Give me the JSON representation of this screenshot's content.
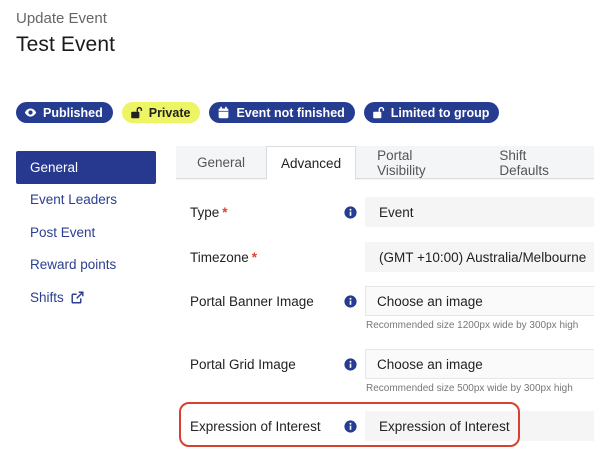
{
  "header": {
    "subtitle": "Update Event",
    "title": "Test Event"
  },
  "badges": [
    {
      "label": "Published",
      "icon": "eye-icon",
      "color": "#263c91"
    },
    {
      "label": "Private",
      "icon": "unlock-icon",
      "color": "#eef564"
    },
    {
      "label": "Event not finished",
      "icon": "calendar-icon",
      "color": "#263c91"
    },
    {
      "label": "Limited to group",
      "icon": "unlock-icon",
      "color": "#263c91"
    }
  ],
  "sidebar": {
    "items": [
      {
        "label": "General",
        "active": true
      },
      {
        "label": "Event Leaders"
      },
      {
        "label": "Post Event"
      },
      {
        "label": "Reward points"
      },
      {
        "label": "Shifts",
        "icon": "external-link-icon"
      }
    ]
  },
  "tabs": [
    {
      "label": "General"
    },
    {
      "label": "Advanced",
      "active": true
    },
    {
      "label": "Portal Visibility"
    },
    {
      "label": "Shift Defaults"
    }
  ],
  "form": {
    "type": {
      "label": "Type",
      "required": "*",
      "value": "Event"
    },
    "timezone": {
      "label": "Timezone",
      "required": "*",
      "value": "(GMT +10:00) Australia/Melbourne"
    },
    "portal_banner": {
      "label": "Portal Banner Image",
      "value": "Choose an image",
      "help": "Recommended size 1200px wide by 300px high"
    },
    "portal_grid": {
      "label": "Portal Grid Image",
      "value": "Choose an image",
      "help": "Recommended size 500px wide by 300px high"
    },
    "expression": {
      "label": "Expression of Interest",
      "value": "Expression of Interest"
    }
  },
  "colors": {
    "primary": "#263c91",
    "accent": "#eef564",
    "required": "#e0402f",
    "highlight": "#d8412f"
  }
}
